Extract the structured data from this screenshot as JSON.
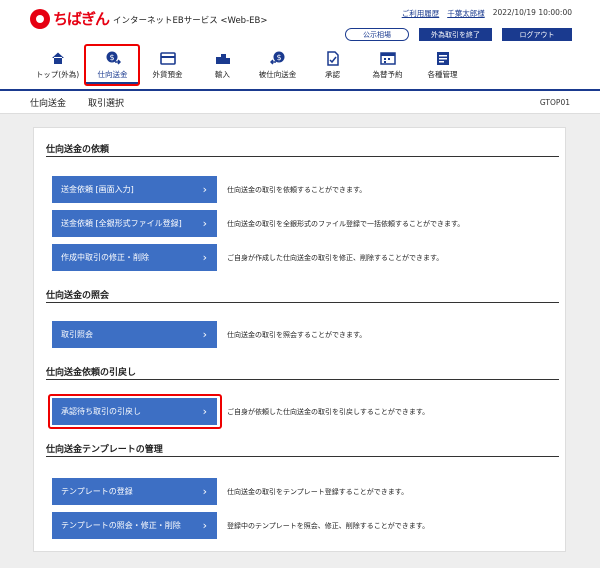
{
  "header": {
    "logo": "ちばぎん",
    "service": "インターネットEBサービス <Web-EB>",
    "links": [
      "ご利用履歴",
      "千葉太郎様"
    ],
    "datetime": "2022/10/19 10:00:00",
    "public_rates": "公示相場",
    "fx_end": "外為取引を終了",
    "logout": "ログアウト"
  },
  "nav": [
    {
      "label": "トップ(外為)",
      "icon": "home-icon"
    },
    {
      "label": "仕向送金",
      "icon": "remittance-icon"
    },
    {
      "label": "外貨預金",
      "icon": "deposit-icon"
    },
    {
      "label": "輸入",
      "icon": "import-icon"
    },
    {
      "label": "被仕向送金",
      "icon": "incoming-remittance-icon"
    },
    {
      "label": "承認",
      "icon": "approval-icon"
    },
    {
      "label": "為替予約",
      "icon": "fx-contract-icon"
    },
    {
      "label": "各種管理",
      "icon": "management-icon"
    }
  ],
  "page": {
    "title": "仕向送金",
    "subtitle": "取引選択",
    "code": "GTOP01"
  },
  "sections": [
    {
      "title": "仕向送金の依頼",
      "actions": [
        {
          "label": "送金依頼 [画面入力]",
          "desc": "仕向送金の取引を依頼することができます。"
        },
        {
          "label": "送金依頼 [全銀形式ファイル登録]",
          "desc": "仕向送金の取引を全銀形式のファイル登録で一括依頼することができます。"
        },
        {
          "label": "作成中取引の修正・削除",
          "desc": "ご自身が作成した仕向送金の取引を修正、削除することができます。"
        }
      ]
    },
    {
      "title": "仕向送金の照会",
      "actions": [
        {
          "label": "取引照会",
          "desc": "仕向送金の取引を照会することができます。"
        }
      ]
    },
    {
      "title": "仕向送金依頼の引戻し",
      "actions": [
        {
          "label": "承認待ち取引の引戻し",
          "desc": "ご自身が依頼した仕向送金の取引を引戻しすることができます。"
        }
      ]
    },
    {
      "title": "仕向送金テンプレートの管理",
      "actions": [
        {
          "label": "テンプレートの登録",
          "desc": "仕向送金の取引をテンプレート登録することができます。"
        },
        {
          "label": "テンプレートの照会・修正・削除",
          "desc": "登録中のテンプレートを照会、修正、削除することができます。"
        }
      ]
    }
  ],
  "colors": {
    "navy": "#1a3a8f",
    "action_blue": "#3d6fc4",
    "brand_red": "#e60012",
    "highlight": "#ee0000"
  }
}
